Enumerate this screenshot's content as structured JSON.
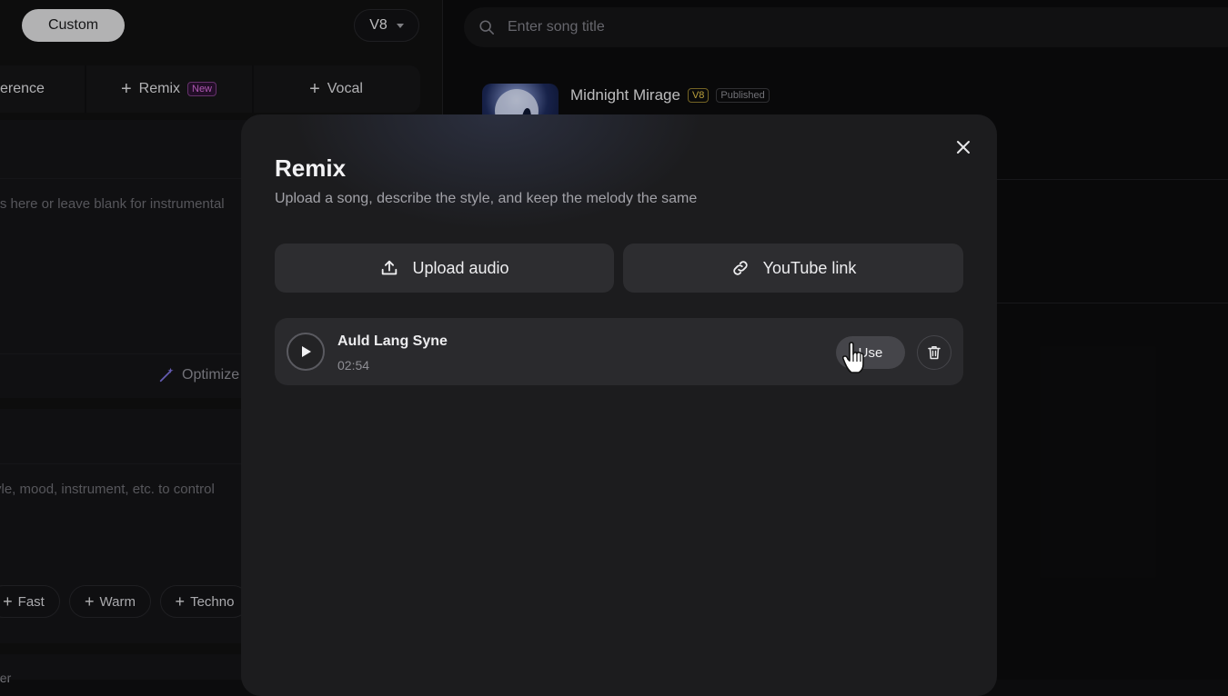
{
  "left_panel": {
    "mode_button": "Custom",
    "version": "V8",
    "tabs": [
      {
        "label": "erence"
      },
      {
        "label": "Remix",
        "badge": "New"
      },
      {
        "label": "Vocal"
      }
    ],
    "lyrics_placeholder": "rics here or leave blank for instrumental",
    "optimize_label": "Optimize",
    "style_placeholder": "yle, mood, instrument, etc. to control",
    "style_chips": [
      "Fast",
      "Warm",
      "Techno"
    ],
    "bottom_label": "der"
  },
  "search": {
    "placeholder": "Enter song title"
  },
  "songs": [
    {
      "title": "Midnight Mirage",
      "version_badge": "V8",
      "status_badge": "Published"
    }
  ],
  "modal": {
    "title": "Remix",
    "subtitle": "Upload a song, describe the style, and keep the melody the same",
    "upload_button": "Upload audio",
    "youtube_button": "YouTube link",
    "track": {
      "name": "Auld Lang Syne",
      "duration": "02:54",
      "use_button": "Use"
    }
  },
  "colors": {
    "background": "#0c0c0d",
    "modal_background": "#1c1c1e",
    "new_badge": "#d56bd8",
    "v8_badge": "#e2c24a"
  },
  "icons": [
    "search-icon",
    "chevron-down-icon",
    "plus-icon",
    "magic-wand-icon",
    "close-icon",
    "upload-icon",
    "link-icon",
    "play-icon",
    "trash-icon",
    "hand-cursor-icon"
  ]
}
